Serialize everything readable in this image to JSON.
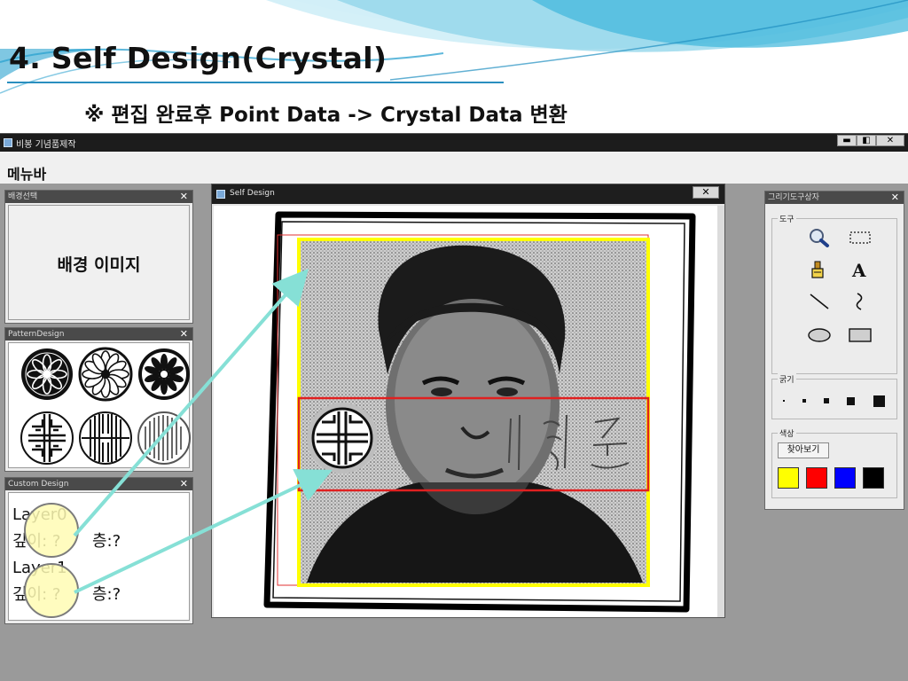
{
  "slide": {
    "title": "4. Self Design(Crystal)",
    "subtitle": "※ 편집 완료후 Point Data -> Crystal Data 변환"
  },
  "app": {
    "title": "비봉 기념품제작",
    "window_buttons": {
      "minimize": "▬",
      "restore": "◧",
      "close": "✕"
    },
    "menubar_label": "메뉴바"
  },
  "panels": {
    "background": {
      "title": "배경선택",
      "label": "배경 이미지",
      "close": "✕"
    },
    "pattern": {
      "title": "PatternDesign",
      "close": "✕"
    },
    "custom": {
      "title": "Custom Design",
      "close": "✕",
      "layers": [
        {
          "name": "Layer0",
          "depth_label": "깊이: ?",
          "floor_label": "층:?"
        },
        {
          "name": "Layer1",
          "depth_label": "깊이: ?",
          "floor_label": "층:?"
        }
      ]
    }
  },
  "self_design": {
    "title": "Self Design",
    "close": "✕"
  },
  "tools": {
    "title": "그리기도구상자",
    "close": "✕",
    "tool_group_label": "도구",
    "thickness_label": "굵기",
    "color_label": "색상",
    "find_button": "찾아보기",
    "tool_icons": [
      "magnifier-icon",
      "select-rect-icon",
      "paint-bucket-icon",
      "text-icon",
      "line-icon",
      "freehand-icon",
      "ellipse-icon",
      "rectangle-icon"
    ],
    "colors": [
      "#ffff00",
      "#ff0000",
      "#0000ff",
      "#000000"
    ],
    "text_tool_glyph": "A"
  }
}
